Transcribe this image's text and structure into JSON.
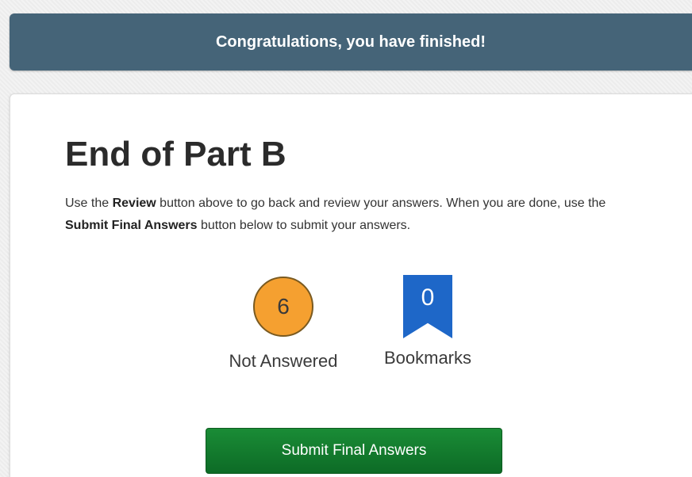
{
  "banner": {
    "text": "Congratulations, you have finished!"
  },
  "main": {
    "title": "End of Part B",
    "instructions": {
      "part1": "Use the ",
      "review_bold": "Review",
      "part2": " button above to go back and review your answers. When you are done, use the ",
      "submit_bold": "Submit Final Answers",
      "part3": " button below to submit your answers."
    },
    "not_answered": {
      "count": "6",
      "label": "Not Answered"
    },
    "bookmarks": {
      "count": "0",
      "label": "Bookmarks"
    },
    "submit_label": "Submit Final Answers"
  },
  "colors": {
    "banner": "#456478",
    "not_answered_circle": "#f5a030",
    "bookmark_ribbon": "#1e67c8",
    "submit_button": "#127a2e"
  },
  "icons": {
    "not_answered": "circle-count-icon",
    "bookmarks": "bookmark-ribbon-icon"
  }
}
